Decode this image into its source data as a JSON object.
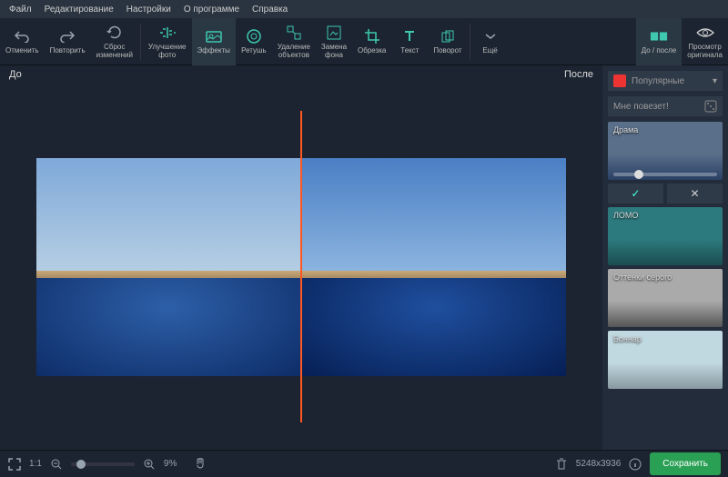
{
  "menu": [
    "Файл",
    "Редактирование",
    "Настройки",
    "О программе",
    "Справка"
  ],
  "tools": {
    "undo": "Отменить",
    "redo": "Повторить",
    "reset": "Сброс\nизменений",
    "enhance": "Улучшение\nфото",
    "effects": "Эффекты",
    "retouch": "Ретушь",
    "remove": "Удаление\nобъектов",
    "bgswap": "Замена\nфона",
    "crop": "Обрезка",
    "text": "Текст",
    "rotate": "Поворот",
    "more": "Ещё",
    "beforeafter": "До / после",
    "original": "Просмотр\nоригинала"
  },
  "viewport": {
    "before": "До",
    "after": "После"
  },
  "sidebar": {
    "popular": "Популярные",
    "lucky": "Мне повезет!",
    "effects": {
      "drama": "Драма",
      "lomo": "ЛОМО",
      "gray": "Оттенки серого",
      "bonnar": "Боннар"
    }
  },
  "status": {
    "scale": "1:1",
    "zoom_pct": "9%",
    "dimensions": "5248x3936",
    "save": "Сохранить"
  }
}
